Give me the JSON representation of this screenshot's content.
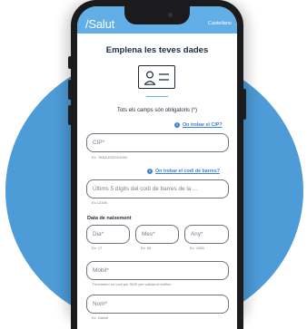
{
  "header": {
    "logo": "/Salut",
    "language": "Castellano"
  },
  "form": {
    "title": "Emplena les teves dades",
    "required_note": "Tots els camps són obligatoris (*)",
    "cip": {
      "help_link": "On trobar el CIP?",
      "placeholder": "CIP*",
      "example": "Ex. TASA1032101002"
    },
    "barcode": {
      "help_link": "On trobar el codi de barres?",
      "placeholder": "Últims 5 dígits del codi de barres de la ...",
      "example": "Ex.12345"
    },
    "birth_date": {
      "label": "Data de naixement",
      "day": {
        "placeholder": "Dia*",
        "example": "Ex. 17"
      },
      "month": {
        "placeholder": "Mes*",
        "example": "Ex. 06"
      },
      "year": {
        "placeholder": "Any*",
        "example": "Ex. 1980"
      }
    },
    "mobile": {
      "placeholder": "Mòbil*",
      "example": "T'enviarem un codi per SMS per validar el telèfon"
    },
    "name": {
      "placeholder": "Nom*",
      "example": "Ex. Daniel"
    }
  },
  "icons": {
    "help": "info-icon",
    "id_card": "id-card-icon"
  },
  "colors": {
    "brand": "#62aee6",
    "link": "#3f7fd4",
    "background_circle": "#4d9bd7",
    "phone_frame": "#1b1b1e"
  }
}
